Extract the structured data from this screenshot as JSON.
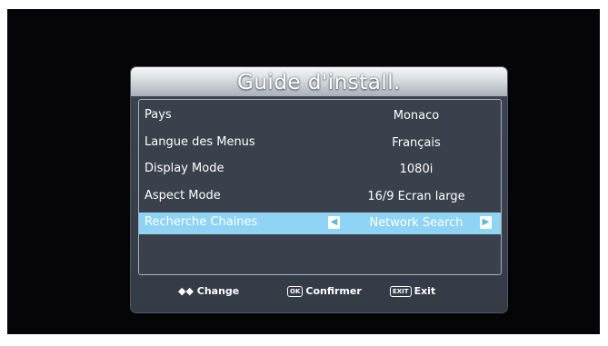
{
  "dialog": {
    "title": "Guide d'install."
  },
  "settings": [
    {
      "label": "Pays",
      "value": "Monaco"
    },
    {
      "label": "Langue des Menus",
      "value": "Français"
    },
    {
      "label": "Display Mode",
      "value": "1080i"
    },
    {
      "label": "Aspect Mode",
      "value": "16/9 Ecran large"
    },
    {
      "label": "Recherche Chaines",
      "value": "Network Search"
    }
  ],
  "footer": {
    "change_symbol": "◆◆",
    "change_label": "Change",
    "ok_key": "OK",
    "confirm_label": "Confirmer",
    "exit_key": "EXIT",
    "exit_label": "Exit"
  },
  "colors": {
    "selected_row": "#8fd4f4",
    "dialog_bg": "#3a414c"
  },
  "icons": {
    "left": "chevron-left-icon",
    "right": "chevron-right-icon"
  }
}
